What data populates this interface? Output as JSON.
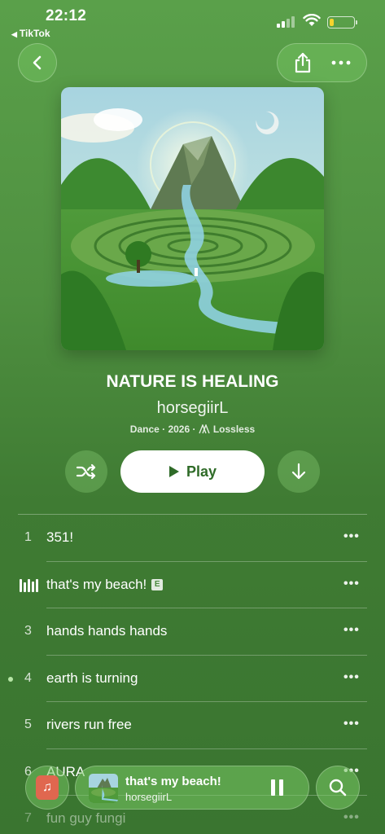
{
  "status_bar": {
    "time": "22:12",
    "back_app": "TikTok",
    "battery_color": "#f6d32d"
  },
  "nav": {
    "back_icon": "chevron-left-icon",
    "share_icon": "share-icon",
    "more_icon": "ellipsis-icon"
  },
  "album": {
    "title": "NATURE IS HEALING",
    "artist": "horsegiirL",
    "meta_text": "Dance · 2026 · ",
    "quality": "Lossless"
  },
  "controls": {
    "play_label": "Play",
    "shuffle_icon": "shuffle-icon",
    "download_icon": "download-icon"
  },
  "tracks": [
    {
      "number": "1",
      "title": "351!",
      "more": "•••"
    },
    {
      "number": "",
      "title": "that's my beach!",
      "explicit": "E",
      "more": "•••",
      "playing": true
    },
    {
      "number": "3",
      "title": "hands hands hands",
      "more": "•••"
    },
    {
      "number": "4",
      "title": "earth is turning",
      "more": "•••"
    },
    {
      "number": "5",
      "title": "rivers run free",
      "more": "•••"
    },
    {
      "number": "6",
      "title": "AURA",
      "more": "•••"
    },
    {
      "number": "7",
      "title": "fun guy fungi",
      "more": "•••"
    }
  ],
  "mini_player": {
    "title": "that's my beach!",
    "artist": "horsegiirL",
    "pause_icon": "pause-icon",
    "search_icon": "search-icon",
    "app_icon": "music-app-icon"
  },
  "colors": {
    "background": "#4c8a3e",
    "play_text": "#2f6b28"
  }
}
